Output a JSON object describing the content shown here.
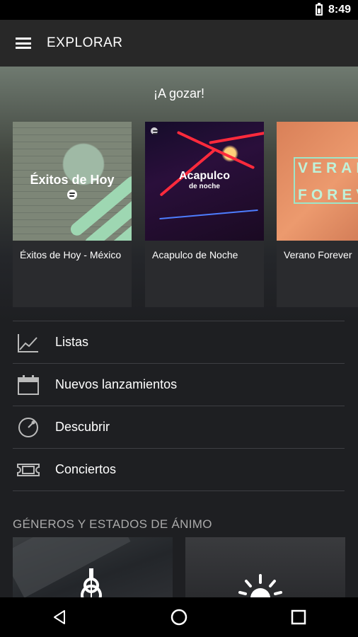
{
  "status_bar": {
    "time": "8:49"
  },
  "app_bar": {
    "title": "EXPLORAR"
  },
  "hero": {
    "title": "¡A gozar!",
    "playlists": [
      {
        "label": "Éxitos de Hoy - México",
        "art_text": "Éxitos de Hoy"
      },
      {
        "label": "Acapulco de Noche",
        "art_text": "Acapulco",
        "art_subtext": "de noche"
      },
      {
        "label": "Verano Forever",
        "art_text_top": "VERANO",
        "art_text_bottom": "FOREVER"
      }
    ]
  },
  "menu": {
    "items": [
      {
        "label": "Listas",
        "icon": "chart-line-icon"
      },
      {
        "label": "Nuevos lanzamientos",
        "icon": "calendar-icon"
      },
      {
        "label": "Descubrir",
        "icon": "compass-icon"
      },
      {
        "label": "Conciertos",
        "icon": "ticket-icon"
      }
    ]
  },
  "genres": {
    "title": "GÉNEROS Y ESTADOS DE ÁNIMO",
    "tiles": [
      {
        "icon": "guitar-icon"
      },
      {
        "icon": "sun-icon"
      }
    ]
  },
  "nav": {
    "buttons": [
      "back-icon",
      "home-icon",
      "recents-icon"
    ]
  },
  "colors": {
    "background": "#1e1f22",
    "app_bar": "#282828",
    "divider": "#3e3f43",
    "accent": "#1db954"
  }
}
